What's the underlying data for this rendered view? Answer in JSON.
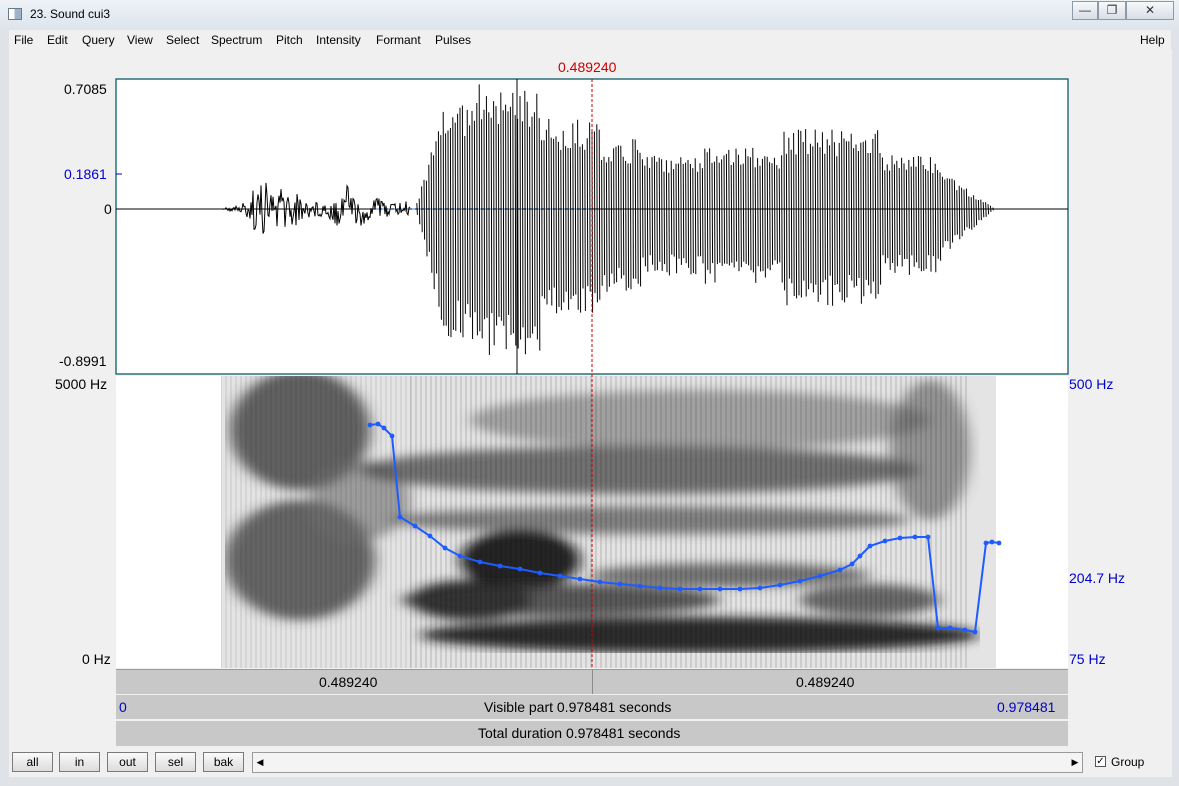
{
  "window": {
    "title": "23. Sound cui3",
    "minimize_icon": "minimize-icon",
    "maximize_icon": "maximize-icon",
    "close_icon": "close-icon"
  },
  "menu": [
    "File",
    "Edit",
    "Query",
    "View",
    "Select",
    "Spectrum",
    "Pitch",
    "Intensity",
    "Formant",
    "Pulses"
  ],
  "help": "Help",
  "cursor_time": "0.489240",
  "waveform": {
    "max": "0.7085",
    "cursor_value": "0.1861",
    "zero": "0",
    "min": "-0.8991"
  },
  "spectrogram": {
    "freq_max": "5000 Hz",
    "freq_min": "0 Hz"
  },
  "pitch": {
    "max": "500 Hz",
    "cursor_value": "204.7 Hz",
    "min": "75 Hz"
  },
  "time_row": {
    "left": "0.489240",
    "right": "0.489240"
  },
  "visible": {
    "start": "0",
    "text": "Visible part 0.978481 seconds",
    "end": "0.978481"
  },
  "total": {
    "text": "Total duration 0.978481 seconds"
  },
  "buttons": {
    "all": "all",
    "in": "in",
    "out": "out",
    "sel": "sel",
    "bak": "bak"
  },
  "group": {
    "label": "Group",
    "checked": true
  },
  "colors": {
    "cursor": "#cc0000",
    "pitch": "#1f5cff",
    "axis_blue": "#0000cc"
  }
}
